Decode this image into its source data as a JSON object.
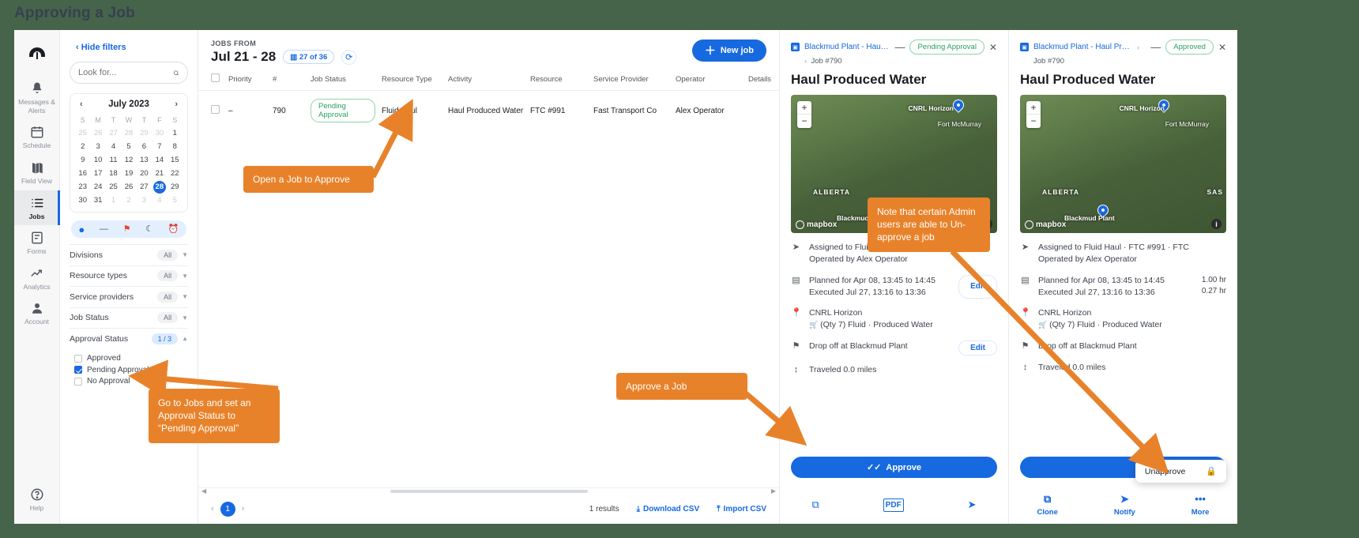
{
  "page": {
    "title": "Approving a Job"
  },
  "sidebar": {
    "items": [
      {
        "label": "Messages &\nAlerts",
        "icon": "bell-icon",
        "active": false
      },
      {
        "label": "Schedule",
        "icon": "calendar-icon",
        "active": false
      },
      {
        "label": "Field View",
        "icon": "map-icon",
        "active": false
      },
      {
        "label": "Jobs",
        "icon": "list-icon",
        "active": true
      },
      {
        "label": "Forms",
        "icon": "form-icon",
        "active": false
      },
      {
        "label": "Analytics",
        "icon": "chart-line-icon",
        "active": false
      },
      {
        "label": "Account",
        "icon": "user-icon",
        "active": false
      }
    ],
    "help_label": "Help"
  },
  "filters": {
    "hide_filters_label": "Hide filters",
    "search_placeholder": "Look for...",
    "calendar": {
      "month_label": "July 2023",
      "dow": [
        "S",
        "M",
        "T",
        "W",
        "T",
        "F",
        "S"
      ],
      "weeks": [
        [
          {
            "d": "25",
            "mute": true
          },
          {
            "d": "26",
            "mute": true
          },
          {
            "d": "27",
            "mute": true
          },
          {
            "d": "28",
            "mute": true
          },
          {
            "d": "29",
            "mute": true
          },
          {
            "d": "30",
            "mute": true
          },
          {
            "d": "1"
          }
        ],
        [
          {
            "d": "2"
          },
          {
            "d": "3"
          },
          {
            "d": "4"
          },
          {
            "d": "5"
          },
          {
            "d": "6"
          },
          {
            "d": "7"
          },
          {
            "d": "8"
          }
        ],
        [
          {
            "d": "9"
          },
          {
            "d": "10"
          },
          {
            "d": "11"
          },
          {
            "d": "12"
          },
          {
            "d": "13"
          },
          {
            "d": "14"
          },
          {
            "d": "15"
          }
        ],
        [
          {
            "d": "16"
          },
          {
            "d": "17"
          },
          {
            "d": "18"
          },
          {
            "d": "19"
          },
          {
            "d": "20"
          },
          {
            "d": "21"
          },
          {
            "d": "22"
          }
        ],
        [
          {
            "d": "23"
          },
          {
            "d": "24"
          },
          {
            "d": "25"
          },
          {
            "d": "26"
          },
          {
            "d": "27"
          },
          {
            "d": "28",
            "sel": true
          },
          {
            "d": "29"
          }
        ],
        [
          {
            "d": "30"
          },
          {
            "d": "31"
          },
          {
            "d": "1",
            "mute": true
          },
          {
            "d": "2",
            "mute": true
          },
          {
            "d": "3",
            "mute": true
          },
          {
            "d": "4",
            "mute": true
          },
          {
            "d": "5",
            "mute": true
          }
        ]
      ]
    },
    "quick_icons": [
      "dot-icon",
      "dash-icon",
      "flag-icon",
      "moon-icon",
      "alarm-icon"
    ],
    "rows": [
      {
        "label": "Divisions",
        "value": "All"
      },
      {
        "label": "Resource types",
        "value": "All"
      },
      {
        "label": "Service providers",
        "value": "All"
      },
      {
        "label": "Job Status",
        "value": "All"
      }
    ],
    "approval_status": {
      "label": "Approval Status",
      "value": "1 / 3",
      "options": [
        {
          "label": "Approved",
          "checked": false
        },
        {
          "label": "Pending Approval",
          "checked": true
        },
        {
          "label": "No Approval",
          "checked": false
        }
      ]
    }
  },
  "main": {
    "jobs_from_label": "JOBS FROM",
    "date_range": "Jul 21 - 28",
    "count_pill": "27 of 36",
    "new_job_label": "New job",
    "columns": [
      "Priority",
      "#",
      "Job Status",
      "Resource Type",
      "Activity",
      "Resource",
      "Service Provider",
      "Operator",
      "Details"
    ],
    "rows": [
      {
        "priority": "–",
        "number": "790",
        "job_status": "Pending Approval",
        "resource_type": "Fluid Haul",
        "activity": "Haul Produced Water",
        "resource": "FTC #991",
        "service_provider": "Fast Transport Co",
        "operator": "Alex Operator",
        "details": ""
      }
    ],
    "footer": {
      "page": "1",
      "results": "1 results",
      "download_csv": "Download CSV",
      "import_csv": "Import CSV"
    }
  },
  "card_pending": {
    "breadcrumb": "Blackmud Plant - Haul Prod...",
    "job_number": "Job #790",
    "status_chip": "Pending Approval",
    "title": "Haul Produced Water",
    "map": {
      "labels": [
        "CNRL Horizon",
        "Fort McMurray",
        "ALBERTA",
        "Blackmud Plant"
      ],
      "attribution": "mapbox",
      "zoom_in": "+",
      "zoom_out": "−"
    },
    "details": [
      {
        "icon": "navigation-icon",
        "line1": "Assigned to Fluid Haul · FTC #991 · FTC",
        "line2": "Operated by Alex Operator"
      },
      {
        "icon": "calendar-icon",
        "line1": "Planned for Apr 08, 13:45 to 14:45",
        "line2": "Executed Jul 27, 13:16 to 13:36",
        "action": "Edit"
      },
      {
        "icon": "pin-icon",
        "line1": "CNRL Horizon",
        "line2": "(Qty 7) Fluid · Produced Water"
      },
      {
        "icon": "flag-icon",
        "line1": "Drop off at Blackmud Plant",
        "action": "Edit"
      },
      {
        "icon": "distance-icon",
        "line1": "Traveled 0.0 miles"
      }
    ],
    "approve_label": "Approve",
    "actions": [
      {
        "icon": "copy-icon",
        "label": ""
      },
      {
        "icon": "pdf-icon",
        "label": ""
      },
      {
        "icon": "send-icon",
        "label": ""
      }
    ]
  },
  "card_approved": {
    "breadcrumb": "Blackmud Plant - Haul Prod...",
    "job_number": "Job #790",
    "status_chip": "Approved",
    "title": "Haul Produced Water",
    "map": {
      "labels": [
        "CNRL Horizon",
        "Fort McMurray",
        "ALBERTA",
        "SAS",
        "Blackmud Plant"
      ],
      "attribution": "mapbox",
      "zoom_in": "+",
      "zoom_out": "−"
    },
    "details": [
      {
        "icon": "navigation-icon",
        "line1": "Assigned to Fluid Haul · FTC #991 · FTC",
        "line2": "Operated by Alex Operator"
      },
      {
        "icon": "calendar-icon",
        "line1": "Planned for Apr 08, 13:45 to 14:45",
        "line2": "Executed Jul 27, 13:16 to 13:36",
        "right1": "1.00 hr",
        "right2": "0.27 hr"
      },
      {
        "icon": "pin-icon",
        "line1": "CNRL Horizon",
        "line2": "(Qty 7) Fluid · Produced Water"
      },
      {
        "icon": "flag-icon",
        "line1": "Drop off at Blackmud Plant"
      },
      {
        "icon": "distance-icon",
        "line1": "Traveled 0.0 miles"
      }
    ],
    "unapprove_label": "Unapprove",
    "actions": [
      {
        "icon": "copy-icon",
        "label": "Clone"
      },
      {
        "icon": "send-icon",
        "label": "Notify"
      },
      {
        "icon": "dots-icon",
        "label": "More"
      }
    ]
  },
  "annotations": [
    {
      "id": "open-job",
      "text": "Open a Job to Approve"
    },
    {
      "id": "approval-status",
      "text": "Go to Jobs and set an Approval Status to “Pending Approval”"
    },
    {
      "id": "approve-job",
      "text": "Approve a Job"
    },
    {
      "id": "unapprove-note",
      "text": "Note that certain Admin users are able to Un-approve a job"
    }
  ],
  "colors": {
    "accent": "#1769e0",
    "annotation": "#e8822a",
    "success": "#27a35e",
    "background": "#46644a"
  }
}
